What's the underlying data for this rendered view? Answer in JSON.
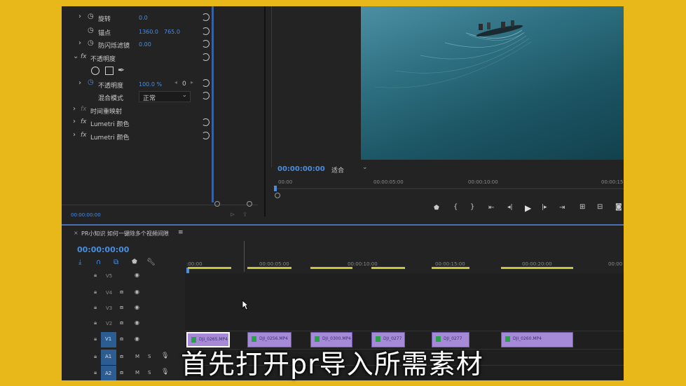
{
  "effects_panel": {
    "rows": [
      {
        "label": "旋转",
        "value": "0.0"
      },
      {
        "label": "锚点",
        "value": "1360.0",
        "value2": "765.0"
      },
      {
        "label": "防闪烁滤镜",
        "value": "0.00"
      }
    ],
    "opacity_title": "不透明度",
    "opacity_label": "不透明度",
    "opacity_value": "100.0 %",
    "opacity_keyframe": "0",
    "blend_label": "混合模式",
    "blend_value": "正常",
    "time_remap": "时间重映射",
    "lumetri1": "Lumetri 颜色",
    "lumetri2": "Lumetri 颜色",
    "timecode": "00:00:00:00"
  },
  "program": {
    "timecode": "00:00:00:00",
    "fit": "适合",
    "ruler": [
      "00:00",
      "00:00:05:00",
      "00:00:10:00",
      "00:00:15"
    ]
  },
  "timeline": {
    "title": "PR小知识 如何一键除多个视频间隙",
    "menu": "≡",
    "timecode": "00:00:00:00",
    "ruler": [
      ":00:00",
      "00:00:05:00",
      "00:00:10:00",
      "00:00:15:00",
      "00:00:20:00",
      "00:00"
    ],
    "tracks": [
      "V5",
      "V4",
      "V3",
      "V2",
      "V1",
      "A1",
      "A2"
    ],
    "track_m": "M",
    "track_s": "S",
    "clips": [
      "DJI_0265.MP4",
      "DJI_0256.MP4",
      "DJI_0300.MP4",
      "DJI_0277",
      "DJI_0277",
      "DJI_0260.MP4"
    ]
  },
  "caption": "首先打开pr导入所需素材"
}
